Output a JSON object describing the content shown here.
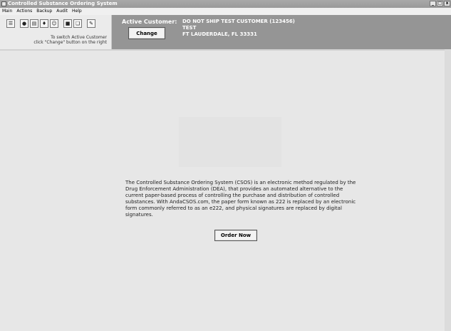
{
  "window": {
    "title": "Controlled Substance Ordering System",
    "buttons": {
      "minimize": "_",
      "maximize": "□",
      "close": "x"
    }
  },
  "menu": [
    "Main",
    "Actions",
    "Backup",
    "Audit",
    "Help"
  ],
  "toolbar": {
    "icons": [
      "order-icon",
      "globe-icon",
      "document-icon",
      "handshake-icon",
      "users-icon",
      "disk-icon",
      "copy-icon",
      "signature-icon"
    ],
    "hint_line1": "To switch Active Customer",
    "hint_line2": "click \"Change\" button on the right"
  },
  "customer": {
    "label": "Active Customer:",
    "name": "DO NOT SHIP TEST CUSTOMER (123456)",
    "line2": "TEST",
    "line3": "FT LAUDERDALE, FL 33331",
    "change_label": "Change"
  },
  "main": {
    "description": "The Controlled Substance Ordering System (CSOS) is an electronic method regulated by the Drug Enforcement Administration (DEA), that provides an automated alternative to the current paper-based process of controlling the purchase and distribution of controlled substances. With AndaCSOS.com, the paper form known as 222 is replaced by an electronic form commonly referred to as an e222, and physical signatures are replaced by digital signatures.",
    "order_now_label": "Order Now"
  }
}
